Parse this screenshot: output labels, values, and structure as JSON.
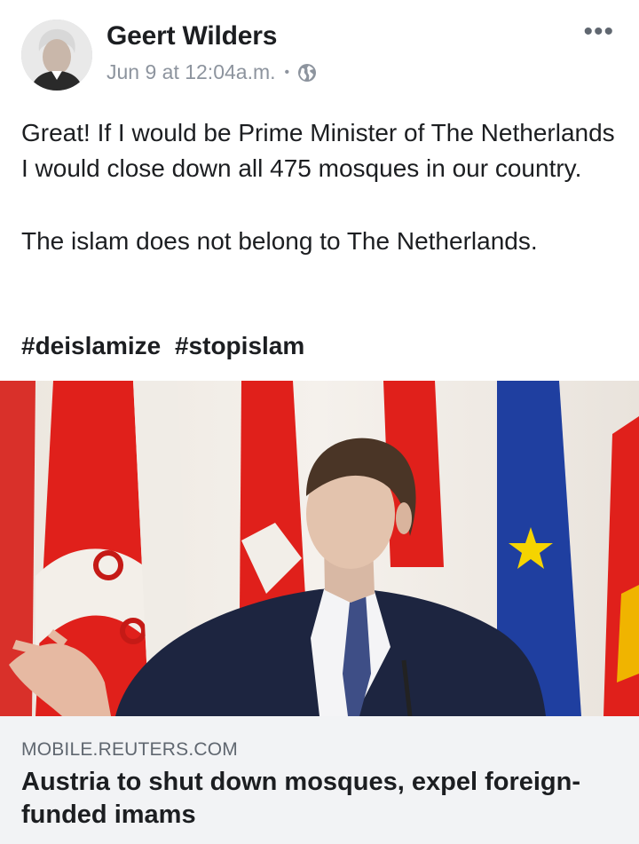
{
  "post": {
    "author": "Geert Wilders",
    "timestamp": "Jun 9 at 12:04a.m.",
    "separator": "•",
    "privacy_icon": "globe-icon",
    "more_label": "•••",
    "text_paragraph_1": "Great! If I would be Prime Minister of The Netherlands I would close down all 475 mosques in our country.",
    "text_paragraph_2": "The islam does not belong to The Netherlands.",
    "hashtags": [
      "#deislamize",
      "#stopislam"
    ]
  },
  "link_preview": {
    "domain": "MOBILE.REUTERS.COM",
    "title": "Austria to shut down mosques, expel foreign-funded imams"
  },
  "colors": {
    "text": "#1c1e21",
    "secondary_text": "#8d949e",
    "link_box_bg": "#f2f3f5",
    "flag_red": "#e0201b",
    "eu_blue": "#1f3fa0",
    "eu_star": "#f5d400"
  }
}
